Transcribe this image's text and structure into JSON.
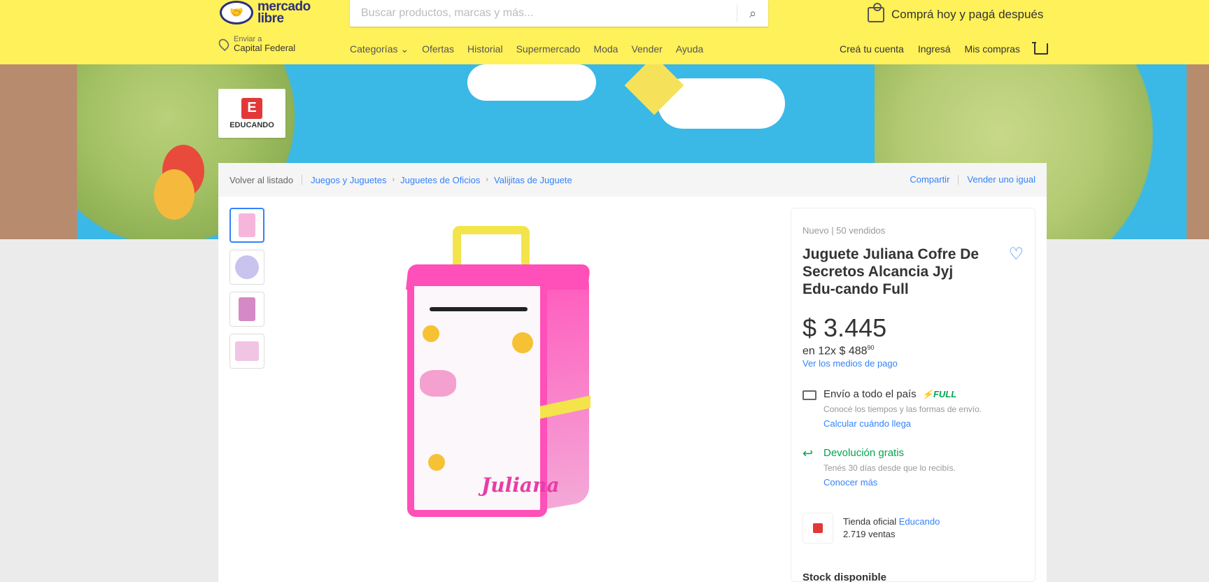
{
  "header": {
    "logo_line1": "mercado",
    "logo_line2": "libre",
    "search_placeholder": "Buscar productos, marcas y más...",
    "promo": "Comprá hoy y pagá después",
    "location_small": "Enviar a",
    "location_big": "Capital Federal",
    "nav": [
      "Categorías ⌄",
      "Ofertas",
      "Historial",
      "Supermercado",
      "Moda",
      "Vender",
      "Ayuda"
    ],
    "account_nav": [
      "Creá tu cuenta",
      "Ingresá",
      "Mis compras"
    ]
  },
  "banner": {
    "store_name": "EDUCANDO",
    "store_letter": "E"
  },
  "breadcrumb": {
    "back": "Volver al listado",
    "items": [
      "Juegos y Juguetes",
      "Juguetes de Oficios",
      "Valijitas de Juguete"
    ],
    "share": "Compartir",
    "sell_same": "Vender uno igual"
  },
  "product": {
    "condition": "Nuevo  |  50 vendidos",
    "title": "Juguete Juliana Cofre De Secretos Alcancia Jyj Edu-cando Full",
    "price": "$ 3.445",
    "installments_prefix": "en 12x $ 488",
    "installments_cents": "90",
    "payment_link": "Ver los medios de pago",
    "toy_label": "Juliana"
  },
  "shipping": {
    "title": "Envío a todo el país",
    "badge": "⚡FULL",
    "note": "Conocé los tiempos y las formas de envío.",
    "link": "Calcular cuándo llega"
  },
  "returns": {
    "title": "Devolución gratis",
    "note": "Tenés 30 días desde que lo recibís.",
    "link": "Conocer más"
  },
  "seller": {
    "label": "Tienda oficial",
    "name": "Educando",
    "sales": "2.719 ventas"
  },
  "stock": "Stock disponible",
  "colors": {
    "header_bg": "#fff159",
    "accent_blue": "#3483fa",
    "green": "#00a650",
    "toy_pink": "#ff4fb8"
  }
}
